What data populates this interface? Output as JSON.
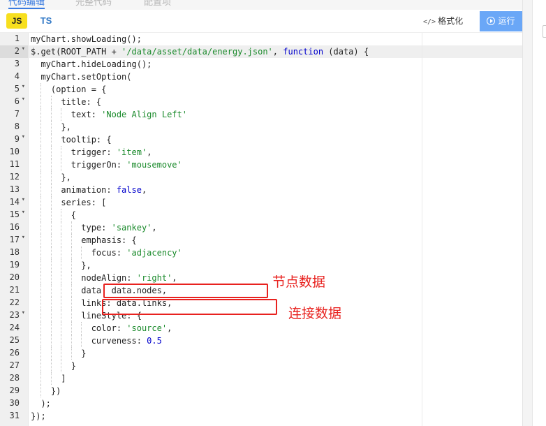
{
  "top_tabs": [
    "代码编辑",
    "完整代码",
    "配置项"
  ],
  "toolbar": {
    "js_label": "JS",
    "ts_label": "TS",
    "format_label": "格式化",
    "run_label": "运行",
    "format_icon": "code-icon",
    "run_icon": "play-circle-icon"
  },
  "editor": {
    "active_line": 2,
    "lines": [
      {
        "n": "1",
        "fold": false,
        "tokens": [
          [
            "p",
            "myChart.showLoading();"
          ]
        ]
      },
      {
        "n": "2",
        "fold": true,
        "tokens": [
          [
            "p",
            "$.get(ROOT_PATH + "
          ],
          [
            "s",
            "'/data/asset/data/energy.json'"
          ],
          [
            "p",
            ", "
          ],
          [
            "k",
            "function"
          ],
          [
            "p",
            " (data) {"
          ]
        ]
      },
      {
        "n": "3",
        "fold": false,
        "tokens": [
          [
            "p",
            "  myChart.hideLoading();"
          ]
        ]
      },
      {
        "n": "4",
        "fold": false,
        "tokens": [
          [
            "p",
            "  myChart.setOption("
          ]
        ]
      },
      {
        "n": "5",
        "fold": true,
        "tokens": [
          [
            "p",
            "    (option = {"
          ]
        ]
      },
      {
        "n": "6",
        "fold": true,
        "tokens": [
          [
            "p",
            "      title: {"
          ]
        ]
      },
      {
        "n": "7",
        "fold": false,
        "tokens": [
          [
            "p",
            "        text: "
          ],
          [
            "s",
            "'Node Align Left'"
          ]
        ]
      },
      {
        "n": "8",
        "fold": false,
        "tokens": [
          [
            "p",
            "      },"
          ]
        ]
      },
      {
        "n": "9",
        "fold": true,
        "tokens": [
          [
            "p",
            "      tooltip: {"
          ]
        ]
      },
      {
        "n": "10",
        "fold": false,
        "tokens": [
          [
            "p",
            "        trigger: "
          ],
          [
            "s",
            "'item'"
          ],
          [
            "p",
            ","
          ]
        ]
      },
      {
        "n": "11",
        "fold": false,
        "tokens": [
          [
            "p",
            "        triggerOn: "
          ],
          [
            "s",
            "'mousemove'"
          ]
        ]
      },
      {
        "n": "12",
        "fold": false,
        "tokens": [
          [
            "p",
            "      },"
          ]
        ]
      },
      {
        "n": "13",
        "fold": false,
        "tokens": [
          [
            "p",
            "      animation: "
          ],
          [
            "k",
            "false"
          ],
          [
            "p",
            ","
          ]
        ]
      },
      {
        "n": "14",
        "fold": true,
        "tokens": [
          [
            "p",
            "      series: ["
          ]
        ]
      },
      {
        "n": "15",
        "fold": true,
        "tokens": [
          [
            "p",
            "        {"
          ]
        ]
      },
      {
        "n": "16",
        "fold": false,
        "tokens": [
          [
            "p",
            "          type: "
          ],
          [
            "s",
            "'sankey'"
          ],
          [
            "p",
            ","
          ]
        ]
      },
      {
        "n": "17",
        "fold": true,
        "tokens": [
          [
            "p",
            "          emphasis: {"
          ]
        ]
      },
      {
        "n": "18",
        "fold": false,
        "tokens": [
          [
            "p",
            "            focus: "
          ],
          [
            "s",
            "'adjacency'"
          ]
        ]
      },
      {
        "n": "19",
        "fold": false,
        "tokens": [
          [
            "p",
            "          },"
          ]
        ]
      },
      {
        "n": "20",
        "fold": false,
        "tokens": [
          [
            "p",
            "          nodeAlign: "
          ],
          [
            "s",
            "'right'"
          ],
          [
            "p",
            ","
          ]
        ]
      },
      {
        "n": "21",
        "fold": false,
        "tokens": [
          [
            "p",
            "          data: data.nodes,"
          ]
        ]
      },
      {
        "n": "22",
        "fold": false,
        "tokens": [
          [
            "p",
            "          links: data.links,"
          ]
        ]
      },
      {
        "n": "23",
        "fold": true,
        "tokens": [
          [
            "p",
            "          lineStyle: {"
          ]
        ]
      },
      {
        "n": "24",
        "fold": false,
        "tokens": [
          [
            "p",
            "            color: "
          ],
          [
            "s",
            "'source'"
          ],
          [
            "p",
            ","
          ]
        ]
      },
      {
        "n": "25",
        "fold": false,
        "tokens": [
          [
            "p",
            "            curveness: "
          ],
          [
            "n",
            "0.5"
          ]
        ]
      },
      {
        "n": "26",
        "fold": false,
        "tokens": [
          [
            "p",
            "          }"
          ]
        ]
      },
      {
        "n": "27",
        "fold": false,
        "tokens": [
          [
            "p",
            "        }"
          ]
        ]
      },
      {
        "n": "28",
        "fold": false,
        "tokens": [
          [
            "p",
            "      ]"
          ]
        ]
      },
      {
        "n": "29",
        "fold": false,
        "tokens": [
          [
            "p",
            "    })"
          ]
        ]
      },
      {
        "n": "30",
        "fold": false,
        "tokens": [
          [
            "p",
            "  );"
          ]
        ]
      },
      {
        "n": "31",
        "fold": false,
        "tokens": [
          [
            "p",
            "});"
          ]
        ]
      }
    ]
  },
  "annotations": {
    "nodes_label": "节点数据",
    "links_label": "连接数据",
    "color": "#e8221f"
  },
  "colors": {
    "string": "#1a8a2b",
    "keyword": "#0000cc",
    "run_button": "#6aa7f7",
    "js_badge": "#f7df1e",
    "ts_text": "#3178c6"
  }
}
